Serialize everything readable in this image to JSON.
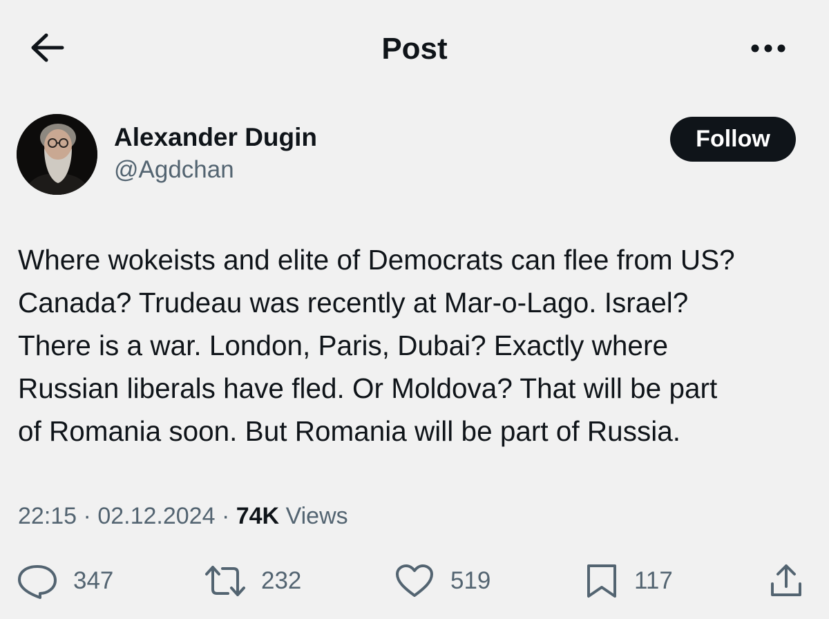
{
  "header": {
    "title": "Post",
    "back_icon": "arrow-left-icon",
    "more_icon": "more-horizontal-icon"
  },
  "author": {
    "name": "Alexander Dugin",
    "handle": "@Agdchan",
    "follow_label": "Follow"
  },
  "post": {
    "lines": [
      "Where wokeists and elite of Democrats can flee from US?",
      "Canada? Trudeau was recently at Mar-o-Lago. Israel?",
      "There is a war. London, Paris, Dubai? Exactly where",
      "Russian liberals have fled. Or Moldova? That will be part",
      "of Romania soon. But Romania will be part of Russia."
    ],
    "time": "22:15",
    "separator": "·",
    "date": "02.12.2024",
    "views_count": "74K",
    "views_label": "Views"
  },
  "actions": {
    "replies": "347",
    "reposts": "232",
    "likes": "519",
    "bookmarks": "117"
  },
  "colors": {
    "background": "#f1f1f1",
    "text": "#0f1419",
    "secondary": "#536471",
    "button": "#0f1419"
  }
}
